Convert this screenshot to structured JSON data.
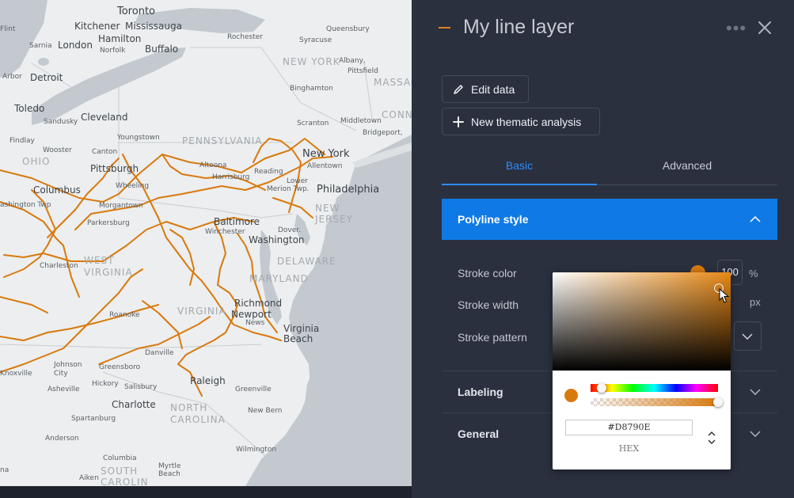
{
  "map": {
    "labels": {
      "toronto": "Toronto",
      "kitchener": "Kitchener",
      "mississauga": "Mississauga",
      "hamilton": "Hamilton",
      "flint": "Flint",
      "sarnia": "Sarnia",
      "london": "London",
      "norfolk": "Norfolk",
      "buffalo": "Buffalo",
      "rochester": "Rochester",
      "syracuse": "Syracuse",
      "queensbury": "Queensbury",
      "arbor": "Arbor",
      "detroit": "Detroit",
      "new_york_state": "NEW YORK",
      "albany": "Albany,",
      "pittsfield": "Pittsfield",
      "massa": "MASSAC",
      "toledo": "Toledo",
      "binghamton": "Binghamton",
      "sandusky": "Sandusky",
      "cleveland": "Cleveland",
      "scranton": "Scranton",
      "middletown": "Middletown",
      "conn": "CONN",
      "findlay": "Findlay",
      "youngstown": "Youngstown",
      "pennsylvania": "PENNSYLVANIA",
      "bridgeport": "Bridgeport,",
      "ohio": "OHIO",
      "wooster": "Wooster",
      "canton": "Canton",
      "new_york_city": "New York",
      "pittsburgh": "Pittsburgh",
      "altoona": "Altoona",
      "allentown": "Allentown",
      "reading": "Reading",
      "harrisburg": "Harrisburg",
      "lower": "Lower",
      "merion": "Merion Twp.",
      "philadelphia": "Philadelphia",
      "columbus": "Columbus",
      "wheeling": "Wheeling",
      "washington_twp": "ashington Twp",
      "morgantown": "Morgantown",
      "new_jersey": "NEW\nJERSEY",
      "parkersburg": "Parkersburg",
      "baltimore": "Baltimore",
      "winchester": "Winchester",
      "dover": "Dover.",
      "washington": "Washington",
      "west_virginia": "WEST\nVIRGINIA",
      "charleston": "Charleston",
      "delaware": "DELAWARE",
      "maryland": "MARYLAND",
      "virginia": "VIRGINIA",
      "richmond": "Richmond",
      "roanoke": "Roanoke",
      "newport": "Newport",
      "news": "News",
      "virginia_beach": "Virginia\nBeach",
      "johnson_city": "Johnson\nCity",
      "danville": "Danville",
      "knoxville": "Knoxville",
      "greensboro": "Greensboro",
      "hickory": "Hickory",
      "salisbury": "Salisbury",
      "raleigh": "Raleigh",
      "asheville": "Asheville",
      "greenville": "Greenville",
      "charlotte": "Charlotte",
      "north_carolina": "NORTH\nCAROLINA",
      "new_bern": "New Bern",
      "spartanburg": "Spartanburg",
      "anderson": "Anderson",
      "wilmington": "Wilmington",
      "columbia": "Columbia",
      "myrtle": "Myrtle\nBeach",
      "south_carolina": "SOUTH\nCAROLIN",
      "aiken": "Aiken",
      "na": "na"
    }
  },
  "panel": {
    "title": "My line layer",
    "more_icon": "•••",
    "edit_data_label": "Edit data",
    "new_analysis_label": "New thematic analysis",
    "tabs": {
      "basic": "Basic",
      "advanced": "Advanced"
    },
    "section_title": "Polyline style",
    "stroke_color_label": "Stroke color",
    "stroke_width_label": "Stroke width",
    "stroke_pattern_label": "Stroke pattern",
    "opacity_value": "100",
    "opacity_unit": "%",
    "width_unit": "px",
    "labeling_label": "Labeling",
    "general_label": "General",
    "accent_color": "#2f8bff",
    "header_bg": "#0f7ae5",
    "stroke_color": "#d8790e"
  },
  "picker": {
    "hex_value": "#D8790E",
    "hex_label": "HEX",
    "base_hue_color": "#e88814",
    "hue_position": 0.09,
    "alpha_position": 1.0
  }
}
